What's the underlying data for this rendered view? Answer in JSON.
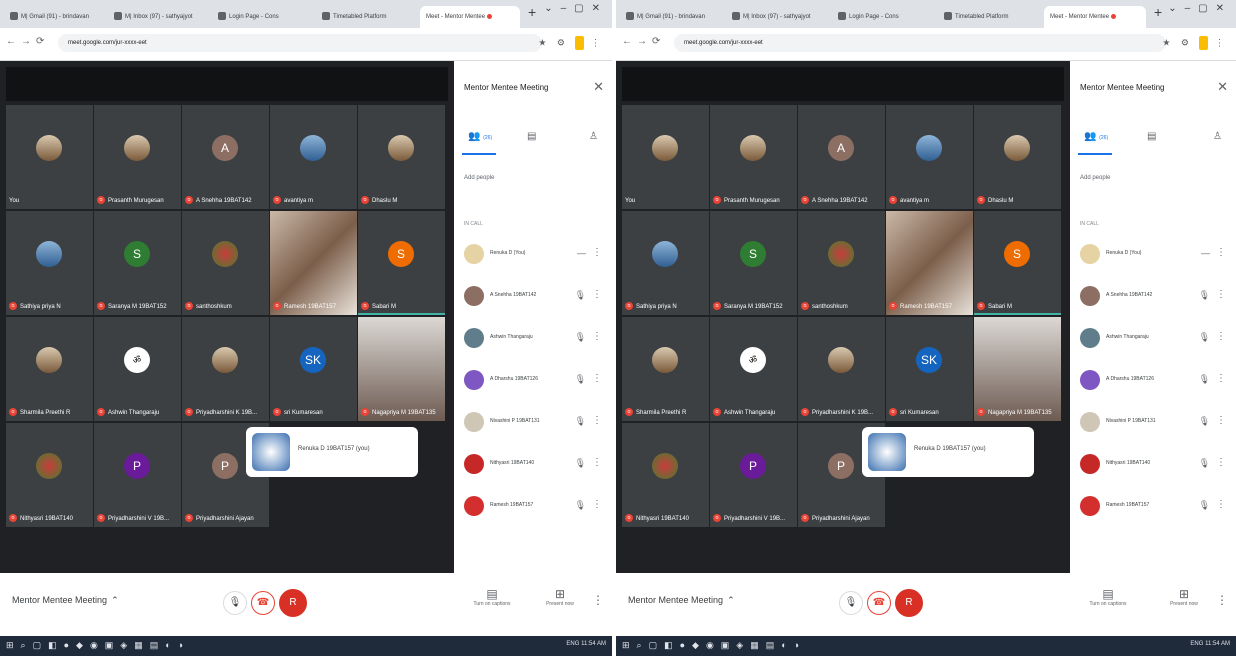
{
  "colors": {
    "meet_bg": "#202124",
    "tile_bg": "#3c4043",
    "mute_red": "#ea4335",
    "accent_blue": "#1a73e8",
    "active_teal": "#41b4a5",
    "taskbar": "#1f2a3a"
  },
  "screens": [
    {
      "browser": {
        "tabs": [
          "M| Gmail (91) - brindavan",
          "M| Inbox (97) - sathyajyot",
          "Login Page - Cons",
          "Timetabled Platform",
          "Meet - Mentor Mentee"
        ],
        "url": "meet.google.com/jur-xxxx-eet"
      },
      "tiles": [
        {
          "name": "You",
          "letter": "",
          "style": "photo"
        },
        {
          "name": "Prasanth Murugesan",
          "letter": "",
          "style": "photo"
        },
        {
          "name": "A Snehha 19BAT142",
          "letter": "A",
          "style": "brown"
        },
        {
          "name": "avantiya m",
          "letter": "",
          "style": "photo2"
        },
        {
          "name": "Dhaslu M",
          "letter": "",
          "style": "photo"
        },
        {
          "name": "Sathiya priya N",
          "letter": "",
          "style": "photo2"
        },
        {
          "name": "Saranya M 19BAT152",
          "letter": "S",
          "style": "green"
        },
        {
          "name": "santhoshkum",
          "letter": "",
          "style": "flower"
        },
        {
          "name": "Ramesh 19BAT157",
          "letter": "",
          "style": "video"
        },
        {
          "name": "Sabari M",
          "letter": "S",
          "style": "orange"
        },
        {
          "name": "Sharmila Preethi R",
          "letter": "",
          "style": "photo"
        },
        {
          "name": "Ashwin Thangaraju",
          "letter": "",
          "style": "logo"
        },
        {
          "name": "Priyadharshini K 19B...",
          "letter": "",
          "style": "photo"
        },
        {
          "name": "sri Kumaresan",
          "letter": "SK",
          "style": "blue"
        },
        {
          "name": "Nagapriya M 19BAT135",
          "letter": "",
          "style": "video"
        },
        {
          "name": "Nithyasri 19BAT140",
          "letter": "",
          "style": "flower"
        },
        {
          "name": "Priyadharshini V 19B...",
          "letter": "P",
          "style": "purple"
        },
        {
          "name": "Priyadharshini Ajayan",
          "letter": "P",
          "style": "brown"
        }
      ],
      "overlay_name": "Renuka D 19BAT157 (you)",
      "panel": {
        "title": "Mentor Mentee Meeting",
        "close": "✕",
        "tab_people": "(26)",
        "add_people": "Add people",
        "section": "IN CALL",
        "participants": [
          {
            "name": "Renuka D (You)"
          },
          {
            "name": "A Snehha 19BAT142"
          },
          {
            "name": "Ashwin Thangaraju"
          },
          {
            "name": "A Dharshu 19BAT126"
          },
          {
            "name": "Nivashini P 19BAT131"
          },
          {
            "name": "Nithyasri 19BAT140"
          },
          {
            "name": "Ramesh 19BAT157"
          }
        ]
      },
      "bottom": {
        "meeting_title": "Mentor Mentee Meeting",
        "chevron": "⌃",
        "avatar_letter": "R",
        "captions": "Turn on captions",
        "present": "Present now"
      },
      "taskbar": {
        "tray": "ENG 11:54 AM"
      }
    },
    {
      "browser": {
        "tabs": [
          "M| Gmail (91) - brindavan",
          "M| Inbox (97) - sathyajyot",
          "Login Page - Cons",
          "Timetabled Platform",
          "Meet - Mentor Mentee"
        ],
        "url": "meet.google.com/jur-xxxx-eet"
      },
      "tiles": [
        {
          "name": "You",
          "letter": "",
          "style": "photo"
        },
        {
          "name": "Prasanth Murugesan",
          "letter": "",
          "style": "photo"
        },
        {
          "name": "A Snehha 19BAT142",
          "letter": "A",
          "style": "brown"
        },
        {
          "name": "avantiya m",
          "letter": "",
          "style": "photo2"
        },
        {
          "name": "Dhaslu M",
          "letter": "",
          "style": "photo"
        },
        {
          "name": "Sathiya priya N",
          "letter": "",
          "style": "photo2"
        },
        {
          "name": "Saranya M 19BAT152",
          "letter": "S",
          "style": "green"
        },
        {
          "name": "santhoshkum",
          "letter": "",
          "style": "flower"
        },
        {
          "name": "Ramesh 19BAT157",
          "letter": "",
          "style": "video"
        },
        {
          "name": "Sabari M",
          "letter": "S",
          "style": "orange"
        },
        {
          "name": "Sharmila Preethi R",
          "letter": "",
          "style": "photo"
        },
        {
          "name": "Ashwin Thangaraju",
          "letter": "",
          "style": "logo"
        },
        {
          "name": "Priyadharshini K 19B...",
          "letter": "",
          "style": "photo"
        },
        {
          "name": "sri Kumaresan",
          "letter": "SK",
          "style": "blue"
        },
        {
          "name": "Nagapriya M 19BAT135",
          "letter": "",
          "style": "video"
        },
        {
          "name": "Nithyasri 19BAT140",
          "letter": "",
          "style": "flower"
        },
        {
          "name": "Priyadharshini V 19B...",
          "letter": "P",
          "style": "purple"
        },
        {
          "name": "Priyadharshini Ajayan",
          "letter": "P",
          "style": "brown"
        }
      ],
      "overlay_name": "Renuka D 19BAT157 (you)",
      "panel": {
        "title": "Mentor Mentee Meeting",
        "close": "✕",
        "tab_people": "(26)",
        "add_people": "Add people",
        "section": "IN CALL",
        "participants": [
          {
            "name": "Renuka D (You)"
          },
          {
            "name": "A Snehha 19BAT142"
          },
          {
            "name": "Ashwin Thangaraju"
          },
          {
            "name": "A Dharshu 19BAT126"
          },
          {
            "name": "Nivashini P 19BAT131"
          },
          {
            "name": "Nithyasri 19BAT140"
          },
          {
            "name": "Ramesh 19BAT157"
          }
        ]
      },
      "bottom": {
        "meeting_title": "Mentor Mentee Meeting",
        "chevron": "⌃",
        "avatar_letter": "R",
        "captions": "Turn on captions",
        "present": "Present now"
      },
      "taskbar": {
        "tray": "ENG 11:54 AM"
      }
    }
  ]
}
